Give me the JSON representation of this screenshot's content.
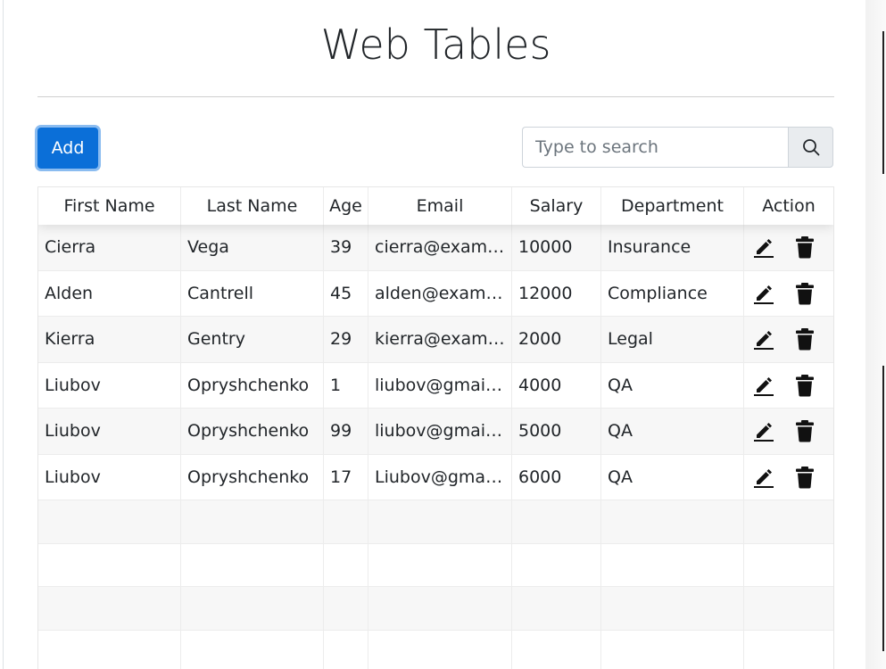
{
  "page_title": "Web Tables",
  "add_button_label": "Add",
  "search": {
    "placeholder": "Type to search"
  },
  "icons": {
    "search": "search-icon",
    "edit": "pencil-icon",
    "delete": "trash-icon"
  },
  "colors": {
    "primary": "#0b6fd8",
    "stripe": "#f7f7f7"
  },
  "table": {
    "headers": [
      "First Name",
      "Last Name",
      "Age",
      "Email",
      "Salary",
      "Department",
      "Action"
    ],
    "rows": [
      {
        "first_name": "Cierra",
        "last_name": "Vega",
        "age": "39",
        "email": "cierra@example.com",
        "salary": "10000",
        "department": "Insurance"
      },
      {
        "first_name": "Alden",
        "last_name": "Cantrell",
        "age": "45",
        "email": "alden@example.com",
        "salary": "12000",
        "department": "Compliance"
      },
      {
        "first_name": "Kierra",
        "last_name": "Gentry",
        "age": "29",
        "email": "kierra@example.com",
        "salary": "2000",
        "department": "Legal"
      },
      {
        "first_name": "Liubov",
        "last_name": "Opryshchenko",
        "age": "1",
        "email": "liubov@gmail.com",
        "salary": "4000",
        "department": "QA"
      },
      {
        "first_name": "Liubov",
        "last_name": "Opryshchenko",
        "age": "99",
        "email": "liubov@gmail.com",
        "salary": "5000",
        "department": "QA"
      },
      {
        "first_name": "Liubov",
        "last_name": "Opryshchenko",
        "age": "17",
        "email": "Liubov@gmail.com",
        "salary": "6000",
        "department": "QA"
      }
    ]
  }
}
